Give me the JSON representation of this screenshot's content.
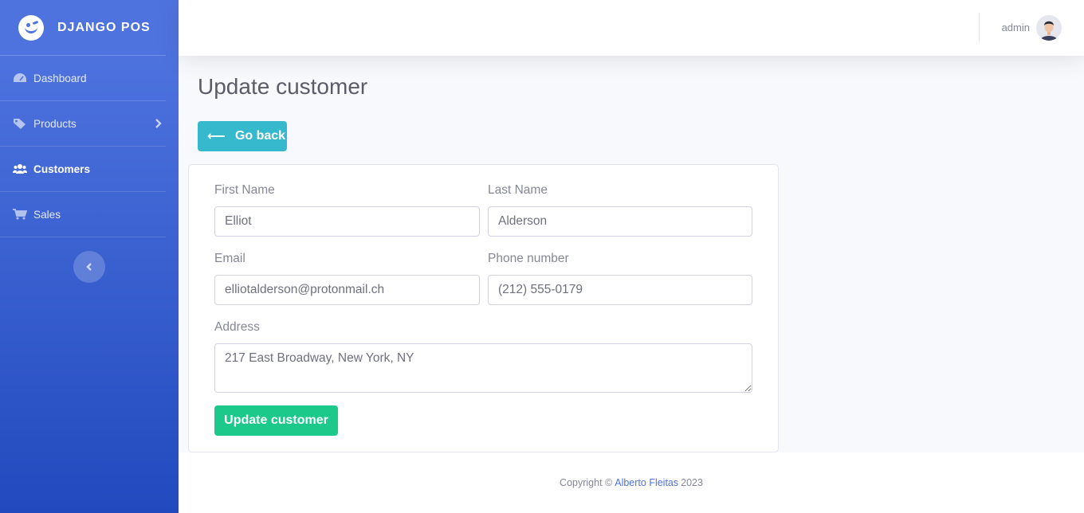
{
  "brand": {
    "name": "DJANGO POS",
    "logo_icon": "winking-face-icon"
  },
  "sidebar": {
    "items": [
      {
        "label": "Dashboard",
        "icon": "tachometer-icon",
        "active": false
      },
      {
        "label": "Products",
        "icon": "tag-icon",
        "active": false,
        "has_submenu": true
      },
      {
        "label": "Customers",
        "icon": "users-icon",
        "active": true
      },
      {
        "label": "Sales",
        "icon": "shopping-cart-icon",
        "active": false
      }
    ]
  },
  "topbar": {
    "user_name": "admin"
  },
  "page": {
    "title": "Update customer",
    "back_label": "Go back"
  },
  "form": {
    "first_name_label": "First Name",
    "first_name_value": "Elliot",
    "last_name_label": "Last Name",
    "last_name_value": "Alderson",
    "email_label": "Email",
    "email_value": "elliotalderson@protonmail.ch",
    "phone_label": "Phone number",
    "phone_value": "(212) 555-0179",
    "address_label": "Address",
    "address_value": "217 East Broadway, New York, NY",
    "submit_label": "Update customer"
  },
  "footer": {
    "prefix": "Copyright ©",
    "author": "Alberto Fleitas",
    "year": "2023"
  },
  "colors": {
    "primary": "#4e73df",
    "info": "#36b9cc",
    "success": "#1cc88a"
  }
}
